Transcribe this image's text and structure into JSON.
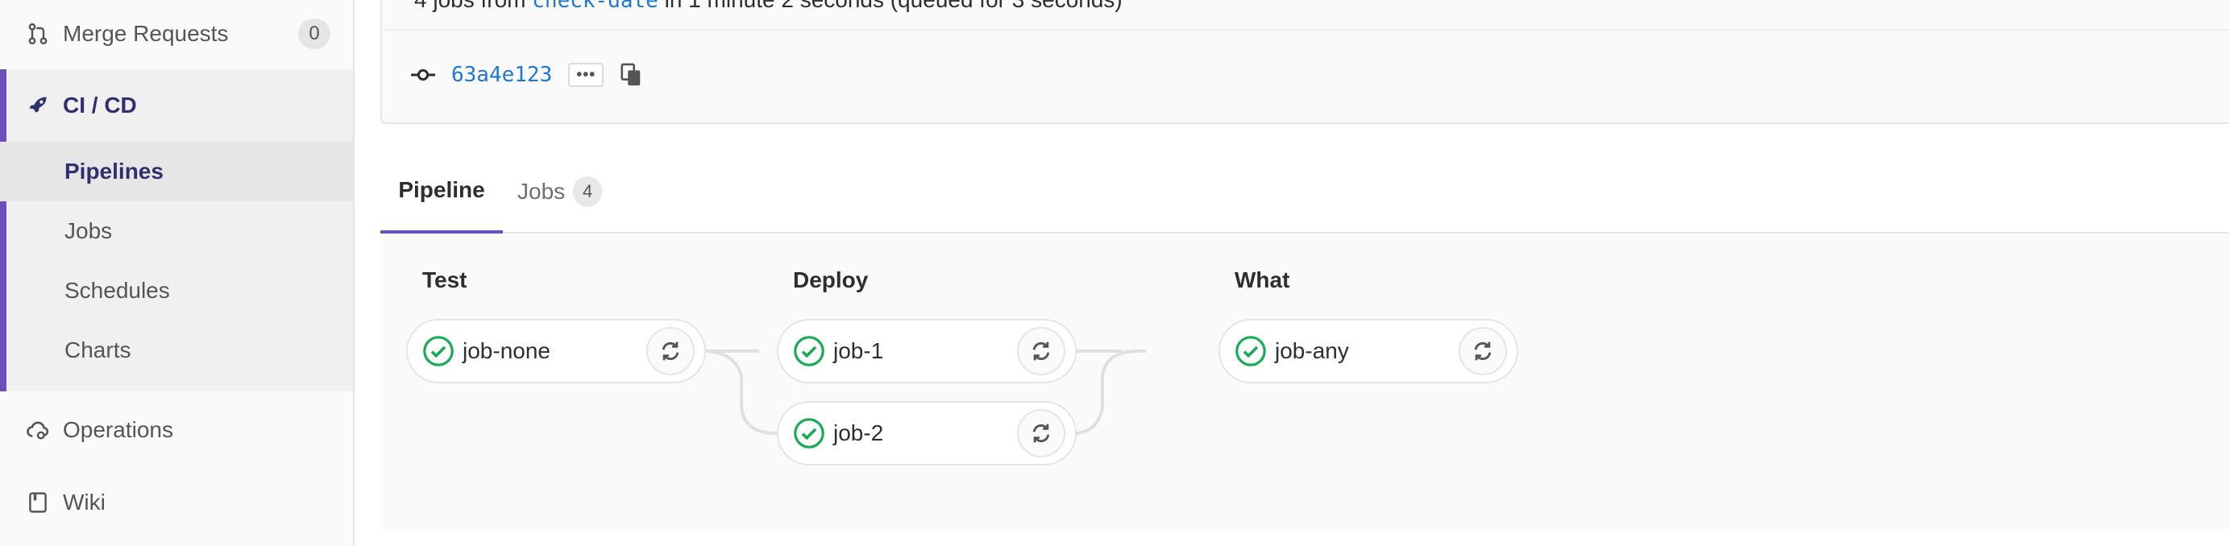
{
  "sidebar": {
    "merge_requests": {
      "label": "Merge Requests",
      "count": "0",
      "icon": "merge-request-icon"
    },
    "cicd": {
      "label": "CI / CD",
      "icon": "rocket-icon"
    },
    "cicd_items": [
      {
        "label": "Pipelines",
        "active": true
      },
      {
        "label": "Jobs"
      },
      {
        "label": "Schedules"
      },
      {
        "label": "Charts"
      }
    ],
    "operations": {
      "label": "Operations",
      "icon": "cloud-gear-icon"
    },
    "wiki": {
      "label": "Wiki",
      "icon": "book-icon"
    }
  },
  "header": {
    "summary_prefix": "4 jobs from ",
    "summary_ref": "check-date",
    "summary_suffix": " in 1 minute 2 seconds (queued for 3 seconds)",
    "commit_sha": "63a4e123",
    "ellipsis": "•••"
  },
  "tabs": [
    {
      "label": "Pipeline"
    },
    {
      "label": "Jobs",
      "count": "4"
    }
  ],
  "pipeline": {
    "stages": [
      {
        "name": "Test",
        "jobs": [
          {
            "name": "job-none",
            "status": "success"
          }
        ]
      },
      {
        "name": "Deploy",
        "jobs": [
          {
            "name": "job-1",
            "status": "success"
          },
          {
            "name": "job-2",
            "status": "success"
          }
        ]
      },
      {
        "name": "What",
        "jobs": [
          {
            "name": "job-any",
            "status": "success"
          }
        ]
      }
    ]
  },
  "colors": {
    "accent": "#6b4fbb",
    "success": "#1aaa55",
    "link": "#1f78d1"
  }
}
